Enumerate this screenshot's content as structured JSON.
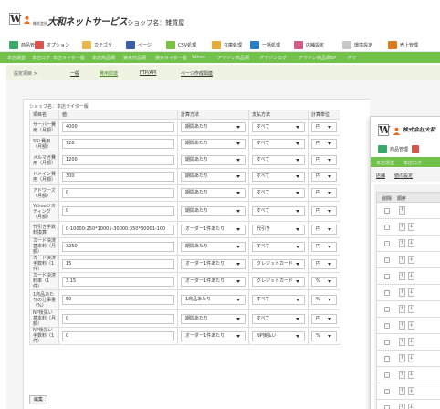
{
  "header": {
    "title_prefix": "株式会社",
    "brand": "大和ネットサービス",
    "title_suffix": "ショップ名：雑貨屋"
  },
  "toolbar": [
    {
      "label": "商品管理",
      "icon": "product-icon",
      "color": "#3aa86a"
    },
    {
      "label": "オプション",
      "icon": "option-icon",
      "color": "#d9534f"
    },
    {
      "label": "カテゴリ",
      "icon": "category-icon",
      "color": "#e8b84a"
    },
    {
      "label": "ページ",
      "icon": "page-icon",
      "color": "#3b5fa8"
    },
    {
      "label": "CSV処理",
      "icon": "csv-icon",
      "color": "#7ac043"
    },
    {
      "label": "在庫処理",
      "icon": "stock-icon",
      "color": "#e8a83a"
    },
    {
      "label": "一括処理",
      "icon": "batch-icon",
      "color": "#2a7fc4"
    },
    {
      "label": "店舗設定",
      "icon": "store-settings-icon",
      "color": "#d45a8a"
    },
    {
      "label": "環境設定",
      "icon": "env-settings-icon",
      "color": "#c8c8c8"
    },
    {
      "label": "売上管理",
      "icon": "sales-icon",
      "color": "#e07a1a"
    }
  ],
  "menu": [
    "本店運営",
    "本店ログ",
    "本店ライター版",
    "本店商品網",
    "楽天商品網",
    "楽天ライター版",
    "Yahoo",
    "アマゾン商品網",
    "アマゾンログ",
    "アマゾン商品網SP",
    "アマ"
  ],
  "subnav": {
    "crumb": "設定項目 >",
    "tabs": [
      "一般",
      "費用関連",
      "FTP/API",
      "ページ作成関連"
    ],
    "active_index": 1
  },
  "shop_name": "ショップ名：本店ライター版",
  "table": {
    "headers": [
      "項目名",
      "値",
      "計算方法",
      "支払方法",
      "計算単位"
    ],
    "rows": [
      {
        "label": "サーバー費用（月額）",
        "value": "4000",
        "calc": "期間あたり",
        "pay": "すべて",
        "unit": "円"
      },
      {
        "label": "SSL費用（月額）",
        "value": "726",
        "calc": "期間あたり",
        "pay": "すべて",
        "unit": "円"
      },
      {
        "label": "メルマガ費用（月額）",
        "value": "1200",
        "calc": "期間あたり",
        "pay": "すべて",
        "unit": "円"
      },
      {
        "label": "ドメイン費用（月額）",
        "value": "300",
        "calc": "期間あたり",
        "pay": "すべて",
        "unit": "円"
      },
      {
        "label": "アドワーズ（月額）",
        "value": "0",
        "calc": "期間あたり",
        "pay": "すべて",
        "unit": "円"
      },
      {
        "label": "Yahooリスティング（月額）",
        "value": "0",
        "calc": "期間あたり",
        "pay": "すべて",
        "unit": "円"
      },
      {
        "label": "代引き手数料換算",
        "value": "0-10000:250*10001-30000:350*30001-100",
        "calc": "オーダー1件あたり",
        "pay": "代引き",
        "unit": "円"
      },
      {
        "label": "カード決済基本料（月額）",
        "value": "3250",
        "calc": "期間あたり",
        "pay": "すべて",
        "unit": "円"
      },
      {
        "label": "カード決済手数料（1件）",
        "value": "15",
        "calc": "オーダー1件あたり",
        "pay": "クレジットカード",
        "unit": "円"
      },
      {
        "label": "カード決済料率（1件）",
        "value": "3.15",
        "calc": "オーダー1件あたり",
        "pay": "クレジットカード",
        "unit": "%"
      },
      {
        "label": "1商品あたりの仕事量（%）",
        "value": "50",
        "calc": "1商品あたり",
        "pay": "すべて",
        "unit": "%"
      },
      {
        "label": "NP後払い基本料（月額）",
        "value": "0",
        "calc": "期間あたり",
        "pay": "すべて",
        "unit": "円"
      },
      {
        "label": "NP後払い手数料（1件）",
        "value": "0",
        "calc": "オーダー1件あたり",
        "pay": "NP後払い",
        "unit": "%"
      }
    ],
    "edit_label": "編集"
  },
  "win2": {
    "brand": "株式会社大和",
    "toolbar_label": "商品管理",
    "menu": [
      "本店運営",
      "本店ログ"
    ],
    "tabs": [
      "店舗",
      "値の設定"
    ],
    "headers": [
      "削除",
      "順序"
    ]
  }
}
